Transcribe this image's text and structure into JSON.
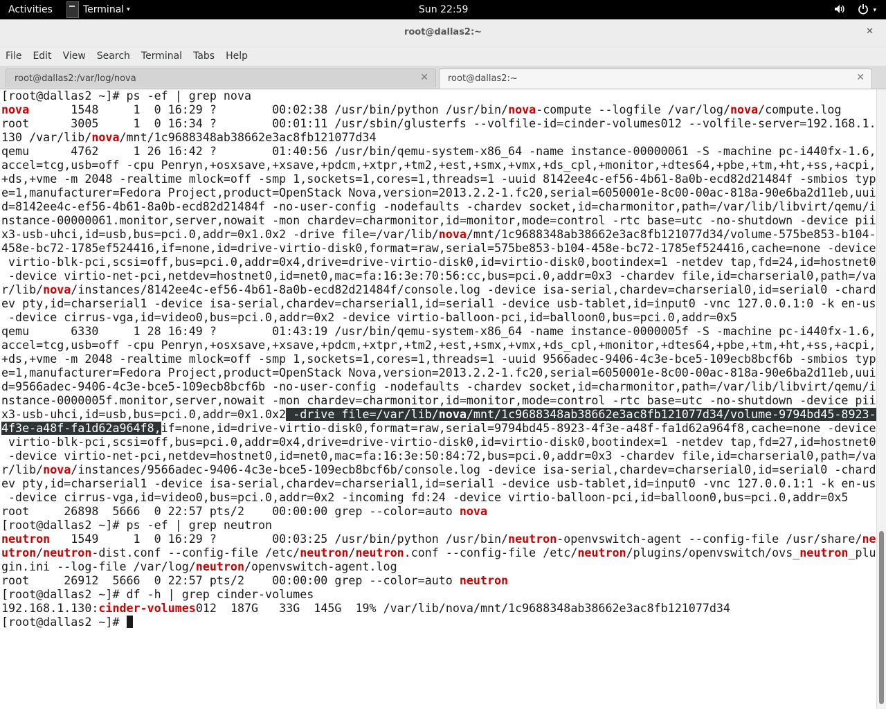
{
  "topbar": {
    "activities": "Activities",
    "app_name": "Terminal",
    "app_caret": "▾",
    "clock": "Sun 22:59",
    "volume_icon": "volume-icon",
    "power_icon": "power-icon",
    "tray_caret": "▾"
  },
  "window": {
    "title": "root@dallas2:~",
    "close_glyph": "✕"
  },
  "menu": [
    "File",
    "Edit",
    "View",
    "Search",
    "Terminal",
    "Tabs",
    "Help"
  ],
  "tabs": [
    {
      "label": "root@dallas2:/var/log/nova",
      "close": "✕",
      "active": false
    },
    {
      "label": "root@dallas2:~",
      "close": "✕",
      "active": true
    }
  ],
  "terminal": {
    "prompt": "[root@dallas2 ~]# ",
    "lines": [
      [
        {
          "t": "[root@dallas2 ~]# ps -ef | grep nova"
        }
      ],
      [
        {
          "t": "nova",
          "h": 1
        },
        {
          "t": "      1548     1  0 16:29 ?        00:02:38 /usr/bin/python /usr/bin/"
        },
        {
          "t": "nova",
          "h": 1
        },
        {
          "t": "-compute --logfile /var/log/"
        },
        {
          "t": "nova",
          "h": 1
        },
        {
          "t": "/compute.log"
        }
      ],
      [
        {
          "t": "root      3005     1  0 16:34 ?        00:01:11 /usr/sbin/glusterfs --volfile-id=cinder-volumes012 --volfile-server=192.168.1."
        }
      ],
      [
        {
          "t": "130 /var/lib/"
        },
        {
          "t": "nova",
          "h": 1
        },
        {
          "t": "/mnt/1c9688348ab38662e3ac8fb121077d34"
        }
      ],
      [
        {
          "t": "qemu      4762     1 26 16:42 ?        01:40:56 /usr/bin/qemu-system-x86_64 -name instance-00000061 -S -machine pc-i440fx-1.6,"
        }
      ],
      [
        {
          "t": "accel=tcg,usb=off -cpu Penryn,+osxsave,+xsave,+pdcm,+xtpr,+tm2,+est,+smx,+vmx,+ds_cpl,+monitor,+dtes64,+pbe,+tm,+ht,+ss,+acpi,"
        }
      ],
      [
        {
          "t": "+ds,+vme -m 2048 -realtime mlock=off -smp 1,sockets=1,cores=1,threads=1 -uuid 8142ee4c-ef56-4b61-8a0b-ecd82d21484f -smbios typ"
        }
      ],
      [
        {
          "t": "e=1,manufacturer=Fedora Project,product=OpenStack Nova,version=2013.2.2-1.fc20,serial=6050001e-8c00-00ac-818a-90e6ba2d11eb,uui"
        }
      ],
      [
        {
          "t": "d=8142ee4c-ef56-4b61-8a0b-ecd82d21484f -no-user-config -nodefaults -chardev socket,id=charmonitor,path=/var/lib/libvirt/qemu/i"
        }
      ],
      [
        {
          "t": "nstance-00000061.monitor,server,nowait -mon chardev=charmonitor,id=monitor,mode=control -rtc base=utc -no-shutdown -device pii"
        }
      ],
      [
        {
          "t": "x3-usb-uhci,id=usb,bus=pci.0,addr=0x1.0x2 -drive file=/var/lib/"
        },
        {
          "t": "nova",
          "h": 1
        },
        {
          "t": "/mnt/1c9688348ab38662e3ac8fb121077d34/volume-575be853-b104-"
        }
      ],
      [
        {
          "t": "458e-bc72-1785ef524416,if=none,id=drive-virtio-disk0,format=raw,serial=575be853-b104-458e-bc72-1785ef524416,cache=none -device"
        }
      ],
      [
        {
          "t": " virtio-blk-pci,scsi=off,bus=pci.0,addr=0x4,drive=drive-virtio-disk0,id=virtio-disk0,bootindex=1 -netdev tap,fd=24,id=hostnet0"
        }
      ],
      [
        {
          "t": " -device virtio-net-pci,netdev=hostnet0,id=net0,mac=fa:16:3e:70:56:cc,bus=pci.0,addr=0x3 -chardev file,id=charserial0,path=/va"
        }
      ],
      [
        {
          "t": "r/lib/"
        },
        {
          "t": "nova",
          "h": 1
        },
        {
          "t": "/instances/8142ee4c-ef56-4b61-8a0b-ecd82d21484f/console.log -device isa-serial,chardev=charserial0,id=serial0 -chard"
        }
      ],
      [
        {
          "t": "ev pty,id=charserial1 -device isa-serial,chardev=charserial1,id=serial1 -device usb-tablet,id=input0 -vnc 127.0.0.1:0 -k en-us"
        }
      ],
      [
        {
          "t": " -device cirrus-vga,id=video0,bus=pci.0,addr=0x2 -device virtio-balloon-pci,id=balloon0,bus=pci.0,addr=0x5"
        }
      ],
      [
        {
          "t": "qemu      6330     1 28 16:49 ?        01:43:19 /usr/bin/qemu-system-x86_64 -name instance-0000005f -S -machine pc-i440fx-1.6,"
        }
      ],
      [
        {
          "t": "accel=tcg,usb=off -cpu Penryn,+osxsave,+xsave,+pdcm,+xtpr,+tm2,+est,+smx,+vmx,+ds_cpl,+monitor,+dtes64,+pbe,+tm,+ht,+ss,+acpi,"
        }
      ],
      [
        {
          "t": "+ds,+vme -m 2048 -realtime mlock=off -smp 1,sockets=1,cores=1,threads=1 -uuid 9566adec-9406-4c3e-bce5-109ecb8bcf6b -smbios typ"
        }
      ],
      [
        {
          "t": "e=1,manufacturer=Fedora Project,product=OpenStack Nova,version=2013.2.2-1.fc20,serial=6050001e-8c00-00ac-818a-90e6ba2d11eb,uui"
        }
      ],
      [
        {
          "t": "d=9566adec-9406-4c3e-bce5-109ecb8bcf6b -no-user-config -nodefaults -chardev socket,id=charmonitor,path=/var/lib/libvirt/qemu/i"
        }
      ],
      [
        {
          "t": "nstance-0000005f.monitor,server,nowait -mon chardev=charmonitor,id=monitor,mode=control -rtc base=utc -no-shutdown -device pii"
        }
      ],
      [
        {
          "t": "x3-usb-uhci,id=usb,bus=pci.0,addr=0x1.0x2"
        },
        {
          "t": " -drive file=/var/lib/",
          "s": 1
        },
        {
          "t": "nova",
          "h": 1,
          "s": 1
        },
        {
          "t": "/mnt/1c9688348ab38662e3ac8fb121077d34/volume-9794bd45-8923-",
          "s": 1
        }
      ],
      [
        {
          "t": "4f3e-a48f-fa1d62a964f8,",
          "s": 1
        },
        {
          "t": "if=none,id=drive-virtio-disk0,format=raw,serial=9794bd45-8923-4f3e-a48f-fa1d62a964f8,cache=none -device"
        }
      ],
      [
        {
          "t": " virtio-blk-pci,scsi=off,bus=pci.0,addr=0x4,drive=drive-virtio-disk0,id=virtio-disk0,bootindex=1 -netdev tap,fd=27,id=hostnet0"
        }
      ],
      [
        {
          "t": " -device virtio-net-pci,netdev=hostnet0,id=net0,mac=fa:16:3e:50:84:72,bus=pci.0,addr=0x3 -chardev file,id=charserial0,path=/va"
        }
      ],
      [
        {
          "t": "r/lib/"
        },
        {
          "t": "nova",
          "h": 1
        },
        {
          "t": "/instances/9566adec-9406-4c3e-bce5-109ecb8bcf6b/console.log -device isa-serial,chardev=charserial0,id=serial0 -chard"
        }
      ],
      [
        {
          "t": "ev pty,id=charserial1 -device isa-serial,chardev=charserial1,id=serial1 -device usb-tablet,id=input0 -vnc 127.0.0.1:1 -k en-us"
        }
      ],
      [
        {
          "t": " -device cirrus-vga,id=video0,bus=pci.0,addr=0x2 -incoming fd:24 -device virtio-balloon-pci,id=balloon0,bus=pci.0,addr=0x5"
        }
      ],
      [
        {
          "t": "root     26898  5666  0 22:57 pts/2    00:00:00 grep --color=auto "
        },
        {
          "t": "nova",
          "h": 1
        }
      ],
      [
        {
          "t": "[root@dallas2 ~]# ps -ef | grep neutron"
        }
      ],
      [
        {
          "t": "neutron",
          "h": 1
        },
        {
          "t": "   1549     1  0 16:29 ?        00:03:25 /usr/bin/python /usr/bin/"
        },
        {
          "t": "neutron",
          "h": 1
        },
        {
          "t": "-openvswitch-agent --config-file /usr/share/"
        },
        {
          "t": "ne",
          "h": 1
        }
      ],
      [
        {
          "t": "utron",
          "h": 1
        },
        {
          "t": "/"
        },
        {
          "t": "neutron",
          "h": 1
        },
        {
          "t": "-dist.conf --config-file /etc/"
        },
        {
          "t": "neutron",
          "h": 1
        },
        {
          "t": "/"
        },
        {
          "t": "neutron",
          "h": 1
        },
        {
          "t": ".conf --config-file /etc/"
        },
        {
          "t": "neutron",
          "h": 1
        },
        {
          "t": "/plugins/openvswitch/ovs_"
        },
        {
          "t": "neutron",
          "h": 1
        },
        {
          "t": "_plu"
        }
      ],
      [
        {
          "t": "gin.ini --log-file /var/log/"
        },
        {
          "t": "neutron",
          "h": 1
        },
        {
          "t": "/openvswitch-agent.log"
        }
      ],
      [
        {
          "t": "root     26912  5666  0 22:57 pts/2    00:00:00 grep --color=auto "
        },
        {
          "t": "neutron",
          "h": 1
        }
      ],
      [
        {
          "t": "[root@dallas2 ~]# df -h | grep cinder-volumes"
        }
      ],
      [
        {
          "t": "192.168.1.130:"
        },
        {
          "t": "cinder-volumes",
          "h": 1
        },
        {
          "t": "012  187G   33G  145G  19% /var/lib/nova/mnt/1c9688348ab38662e3ac8fb121077d34"
        }
      ]
    ]
  }
}
